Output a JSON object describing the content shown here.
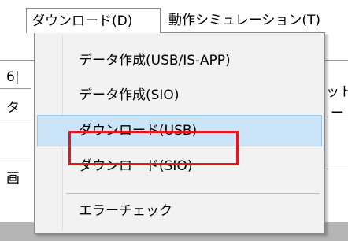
{
  "menubar": {
    "items": [
      {
        "label": "ダウンロード(D)"
      },
      {
        "label": "動作シミュレーション(T)"
      }
    ]
  },
  "background_fragments": {
    "left_1": "6|",
    "left_2": "タ",
    "left_3": "画",
    "right_1": "ット",
    "right_2": "ー"
  },
  "dropdown": {
    "items": [
      {
        "label": "データ作成(USB/IS-APP)"
      },
      {
        "label": "データ作成(SIO)"
      },
      {
        "label": "ダウンロード(USB)"
      },
      {
        "label": "ダウンロード(SIO)"
      },
      {
        "label": "エラーチェック"
      }
    ]
  },
  "colors": {
    "hover_fill": "#cce4f7",
    "hover_border": "#99c9ef",
    "annotation_red": "#e8141b",
    "menu_bg": "#f2f2f2"
  }
}
